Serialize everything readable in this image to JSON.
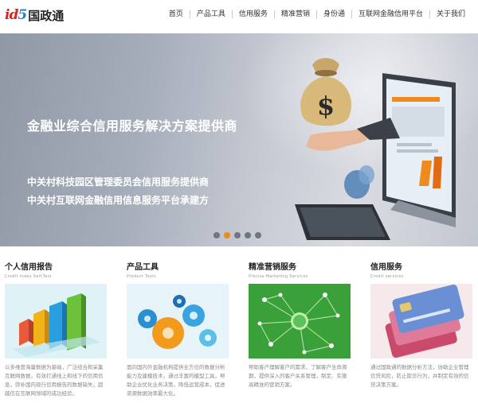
{
  "header": {
    "logo_mark_a": "id",
    "logo_mark_b": "5",
    "logo_text": "国政通",
    "nav": [
      "首页",
      "产品工具",
      "信用服务",
      "精准营销",
      "身份通",
      "互联网金融信用平台",
      "关于我们"
    ]
  },
  "banner": {
    "title": "金融业综合信用服务解决方案提供商",
    "line1": "中关村科技园区管理委员会信用服务提供商",
    "line2": "中关村互联网金融信用信息服务平台承建方",
    "bag_symbol": "$",
    "active_slide": 2,
    "slide_count": 5
  },
  "cards": [
    {
      "title": "个人信用报告",
      "subtitle": "Credit Index Self-Test",
      "desc": "以多维度海量数据为基础，广泛结合和采集互联网数据，有效打通线上和线下的信用信息，弥补国内现行信用报告的数据缺失，超越信在互联网领域的成功经验。"
    },
    {
      "title": "产品工具",
      "subtitle": "Product Tools",
      "desc": "面向国内外金融机构提供全方位的数据分析能力及建模技术，通过丰富的模型工具，帮助企业优化业务决策，降低运营成本，促进资源数据效率最大化。"
    },
    {
      "title": "精准营销服务",
      "subtitle": "Precise Marketing Services",
      "desc": "帮助客户理解客户的需求，了解客户生命周期，提供深入的客户关系管理，制定、实施高精准的营销方案。"
    },
    {
      "title": "信用服务",
      "subtitle": "Credit services",
      "desc": "通过国政通的数据分析方法，协助企业管理信贷风险，防止欺诈行为，并制定有效的信贷决策方案。"
    }
  ],
  "colors": {
    "accent_orange": "#f08a1c",
    "logo_red": "#d8261e",
    "logo_blue": "#2c7fc4",
    "network_green": "#3fa63f",
    "chart_sky": "#d6f0f5"
  }
}
